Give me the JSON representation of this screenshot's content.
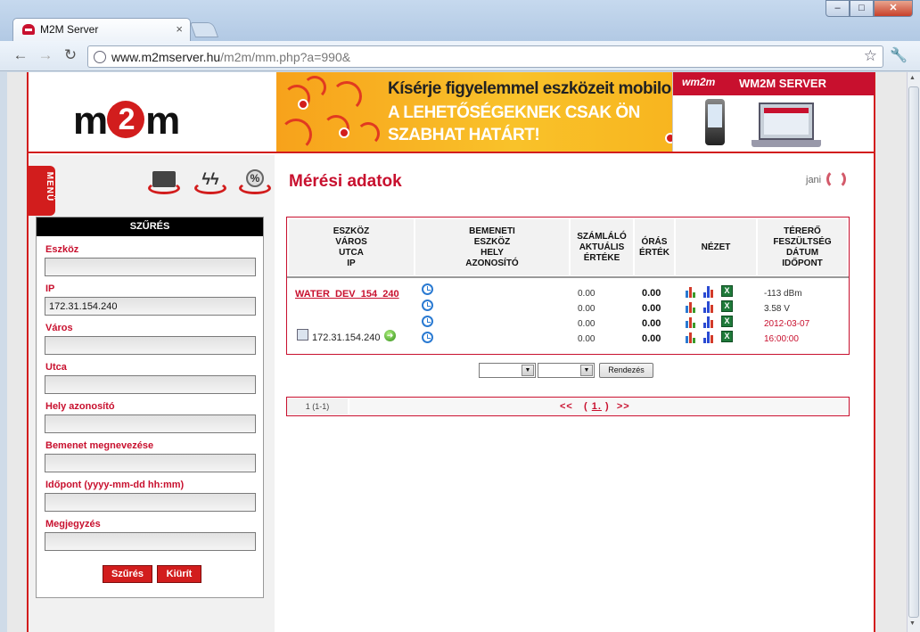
{
  "browser": {
    "tab_title": "M2M Server",
    "tab_close": "×",
    "url_host": "www.m2mserver.hu",
    "url_path": "/m2m/mm.php?a=990&",
    "window_buttons": {
      "minimize": "–",
      "maximize": "□",
      "close": "✕"
    },
    "nav": {
      "back": "←",
      "forward": "→",
      "reload": "↻",
      "star": "☆",
      "wrench": "🔧"
    }
  },
  "header": {
    "logo_left": "m",
    "logo_mid": "2",
    "logo_right": "m",
    "banner": {
      "line1": "Kísérje figyelemmel eszközeit mobilon!",
      "line2": "A LEHETŐSÉGEKNEK CSAK ÖN",
      "line3": "SZABHAT HATÁRT!",
      "brand_logo": "wm2m",
      "brand_label": "WM2M SERVER"
    }
  },
  "sidebar": {
    "menu_label": "MENÜ",
    "filter": {
      "title": "SZŰRÉS",
      "fields": [
        {
          "label": "Eszköz",
          "value": ""
        },
        {
          "label": "IP",
          "value": "172.31.154.240"
        },
        {
          "label": "Város",
          "value": ""
        },
        {
          "label": "Utca",
          "value": ""
        },
        {
          "label": "Hely azonosító",
          "value": ""
        },
        {
          "label": "Bemenet megnevezése",
          "value": ""
        },
        {
          "label": "Időpont (yyyy-mm-dd hh:mm)",
          "value": ""
        },
        {
          "label": "Megjegyzés",
          "value": ""
        }
      ],
      "filter_button": "Szűrés",
      "clear_button": "Kiürít"
    }
  },
  "main": {
    "title": "Mérési adatok",
    "user": "jani",
    "table": {
      "headers": [
        "ESZKÖZ\nVÁROS\nUTCA\nIP",
        "BEMENETI\nESZKÖZ\nHELY\nAZONOSÍTÓ",
        "SZÁMLÁLÓ\nAKTUÁLIS\nÉRTÉKE",
        "ÓRÁS\nÉRTÉK",
        "NÉZET",
        "TÉRERŐ\nFESZÜLTSÉG\nDÁTUM\nIDŐPONT"
      ],
      "row": {
        "device": "WATER_DEV_154_240",
        "ip": "172.31.154.240",
        "counter_values": [
          "0.00",
          "0.00",
          "0.00",
          "0.00"
        ],
        "hourly_values": [
          "0.00",
          "0.00",
          "0.00",
          "0.00"
        ],
        "signal": "-113 dBm",
        "voltage": "3.58 V",
        "date": "2012-03-07",
        "time": "16:00:00"
      }
    },
    "sort_button": "Rendezés",
    "pager": {
      "count": "1  (1-1)",
      "prev": "<<",
      "open_paren": "(",
      "current": "1.",
      "close_paren": ")",
      "next": ">>"
    }
  },
  "colors": {
    "accent": "#c8102e",
    "banner": "#f9b926"
  }
}
